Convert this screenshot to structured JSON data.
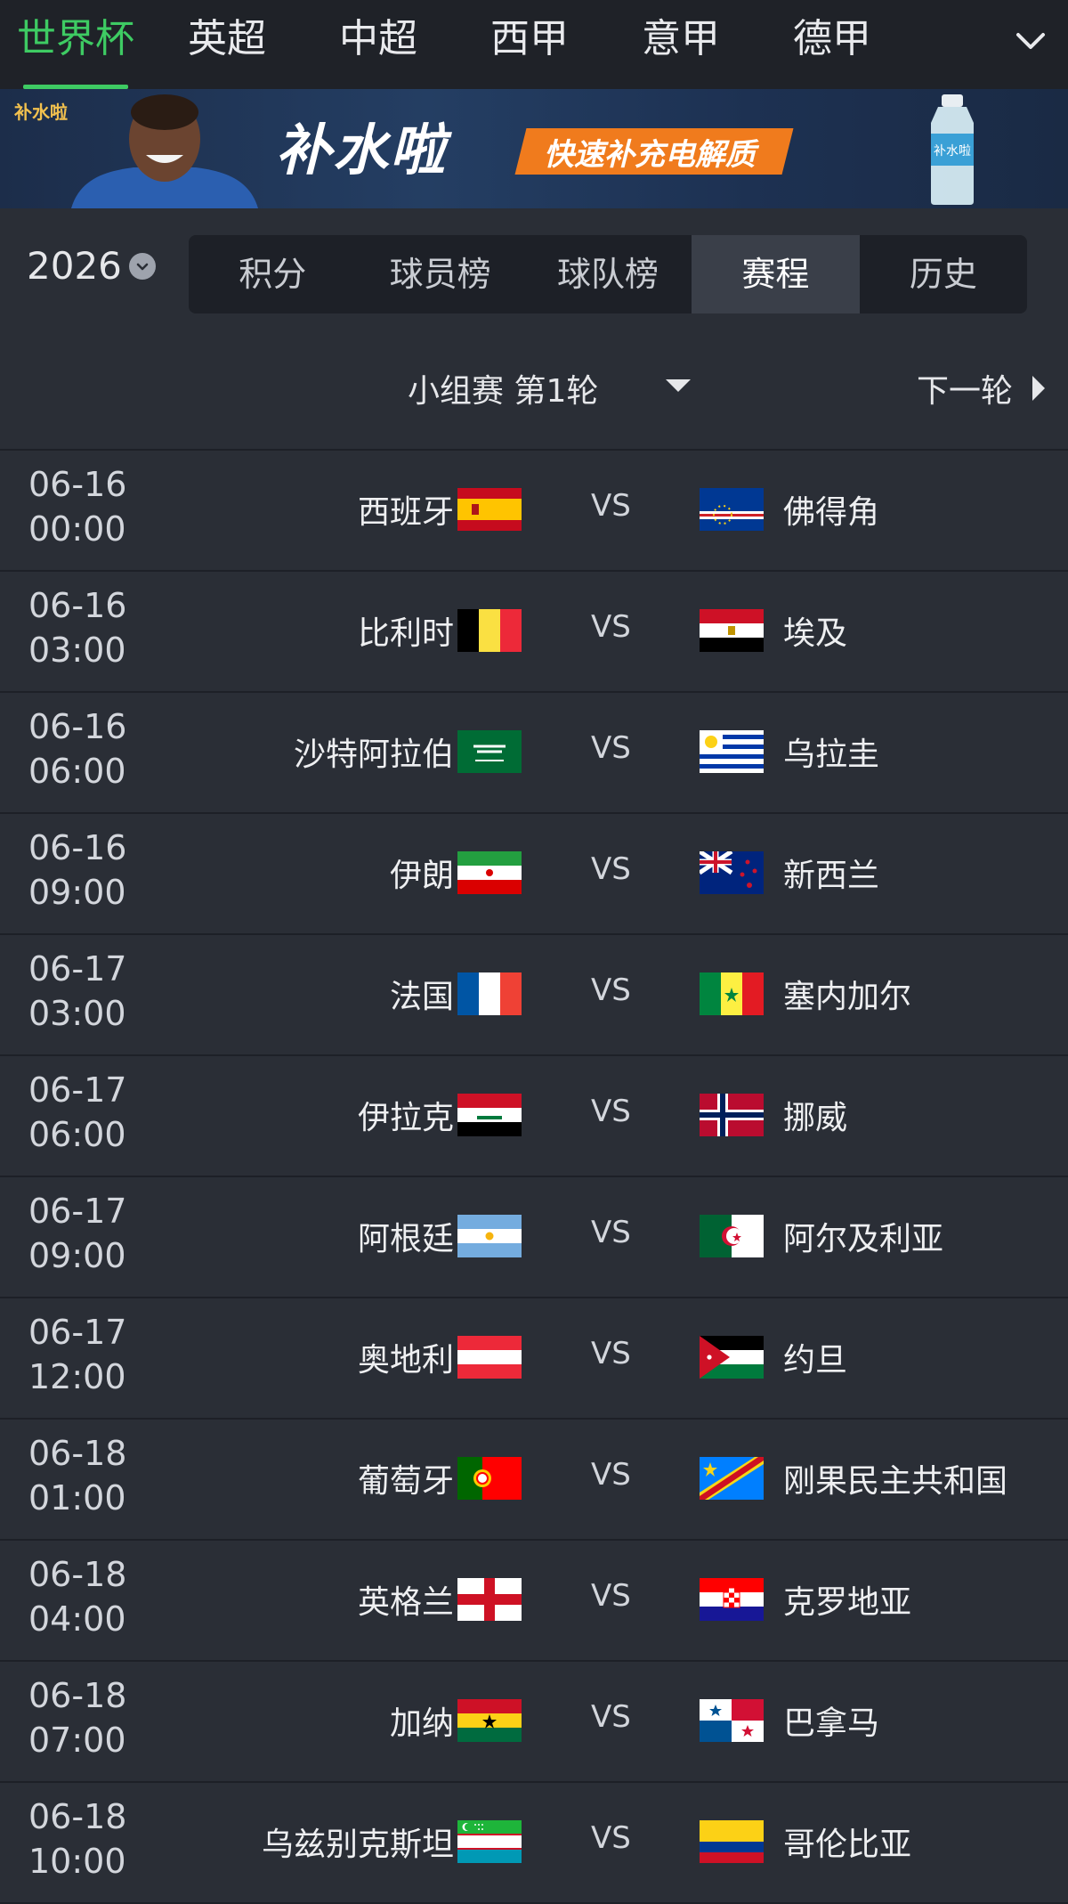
{
  "nav": {
    "tabs": [
      "世界杯",
      "英超",
      "中超",
      "西甲",
      "意甲",
      "德甲"
    ],
    "active_index": 0,
    "more_icon": "chevron-down-icon"
  },
  "banner": {
    "logo_text": "补水啦",
    "brand": "补水啦",
    "slogan": "快速补充电解质",
    "bottle_label": "补水啦"
  },
  "season": {
    "year": "2026"
  },
  "segments": {
    "items": [
      "积分",
      "球员榜",
      "球队榜",
      "赛程",
      "历史"
    ],
    "active_index": 3
  },
  "round": {
    "label": "小组赛 第1轮",
    "next_label": "下一轮"
  },
  "colors": {
    "accent": "#3ecb63",
    "bg": "#2a2e36",
    "nav_bg": "#1f2228"
  },
  "matches": [
    {
      "date": "06-16",
      "time": "00:00",
      "home": "西班牙",
      "home_flag": "spain",
      "away": "佛得角",
      "away_flag": "cape-verde"
    },
    {
      "date": "06-16",
      "time": "03:00",
      "home": "比利时",
      "home_flag": "belgium",
      "away": "埃及",
      "away_flag": "egypt"
    },
    {
      "date": "06-16",
      "time": "06:00",
      "home": "沙特阿拉伯",
      "home_flag": "saudi-arabia",
      "away": "乌拉圭",
      "away_flag": "uruguay"
    },
    {
      "date": "06-16",
      "time": "09:00",
      "home": "伊朗",
      "home_flag": "iran",
      "away": "新西兰",
      "away_flag": "new-zealand"
    },
    {
      "date": "06-17",
      "time": "03:00",
      "home": "法国",
      "home_flag": "france",
      "away": "塞内加尔",
      "away_flag": "senegal"
    },
    {
      "date": "06-17",
      "time": "06:00",
      "home": "伊拉克",
      "home_flag": "iraq",
      "away": "挪威",
      "away_flag": "norway"
    },
    {
      "date": "06-17",
      "time": "09:00",
      "home": "阿根廷",
      "home_flag": "argentina",
      "away": "阿尔及利亚",
      "away_flag": "algeria"
    },
    {
      "date": "06-17",
      "time": "12:00",
      "home": "奥地利",
      "home_flag": "austria",
      "away": "约旦",
      "away_flag": "jordan"
    },
    {
      "date": "06-18",
      "time": "01:00",
      "home": "葡萄牙",
      "home_flag": "portugal",
      "away": "刚果民主共和国",
      "away_flag": "dr-congo"
    },
    {
      "date": "06-18",
      "time": "04:00",
      "home": "英格兰",
      "home_flag": "england",
      "away": "克罗地亚",
      "away_flag": "croatia"
    },
    {
      "date": "06-18",
      "time": "07:00",
      "home": "加纳",
      "home_flag": "ghana",
      "away": "巴拿马",
      "away_flag": "panama"
    },
    {
      "date": "06-18",
      "time": "10:00",
      "home": "乌兹别克斯坦",
      "home_flag": "uzbekistan",
      "away": "哥伦比亚",
      "away_flag": "colombia"
    }
  ],
  "vs_label": "VS"
}
